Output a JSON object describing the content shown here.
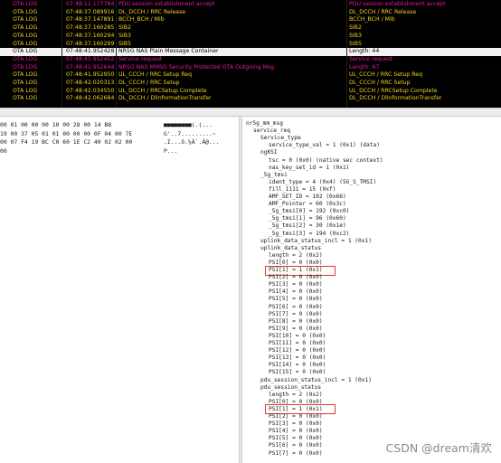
{
  "log": {
    "rows": [
      {
        "type": "OTA LOG",
        "time": "07:48:11.177784",
        "msg": "PDU session establishment accept",
        "info": "PDU session establishment accept",
        "color": "#e6199e"
      },
      {
        "type": "OTA LOG",
        "time": "07:48:37.089916",
        "msg": "DL_DCCH / RRC Release",
        "info": "DL_DCCH / RRC Release",
        "color": "#f2d51c"
      },
      {
        "type": "OTA LOG",
        "time": "07:48:37.147891",
        "msg": "BCCH_BCH / Mib",
        "info": "BCCH_BCH / Mib",
        "color": "#f2d51c"
      },
      {
        "type": "OTA LOG",
        "time": "07:48:37.160285",
        "msg": "SIB2",
        "info": "SIB2",
        "color": "#f2d51c"
      },
      {
        "type": "OTA LOG",
        "time": "07:48:37.160294",
        "msg": "SIB3",
        "info": "SIB3",
        "color": "#f2d51c"
      },
      {
        "type": "OTA LOG",
        "time": "07:48:37.160299",
        "msg": "SIB5",
        "info": "SIB5",
        "color": "#f2d51c"
      },
      {
        "type": "OTA LOG",
        "time": "07:48:41.952428",
        "msg": "NR5G NAS Plain Message Container",
        "info": "Length:  44",
        "color": "#000000",
        "selected": true
      },
      {
        "type": "OTA LOG",
        "time": "07:48:41.952452",
        "msg": "Service request",
        "info": "Service request",
        "color": "#e6199e"
      },
      {
        "type": "OTA LOG",
        "time": "07:48:41.952644",
        "msg": "NR5G NAS MMSG Security Protected OTA Outgoing Msg",
        "info": "Length:  67",
        "color": "#e6199e"
      },
      {
        "type": "OTA LOG",
        "time": "07:48:41.952950",
        "msg": "UL_CCCH / RRC Setup Req",
        "info": "UL_CCCH / RRC Setup Req",
        "color": "#f2d51c"
      },
      {
        "type": "OTA LOG",
        "time": "07:48:42.020313",
        "msg": "DL_CCCH / RRC Setup",
        "info": "DL_CCCH / RRC Setup",
        "color": "#f2d51c"
      },
      {
        "type": "OTA LOG",
        "time": "07:48:42.034550",
        "msg": "UL_DCCH / RRCSetup Complete",
        "info": "UL_DCCH / RRCSetup Complete",
        "color": "#f2d51c"
      },
      {
        "type": "OTA LOG",
        "time": "07:48:42.062684",
        "msg": "DL_DCCH / DlInformationTransfer",
        "info": "DL_DCCH / DlInformationTransfer",
        "color": "#f2d51c"
      }
    ]
  },
  "hex": {
    "lines": [
      {
        "bytes": "00 01 00 00 00 10 00 28 00 14 B8",
        "ascii": "■■■■■■■■(.(..."
      },
      {
        "bytes": "19 00 37 05 01 01 00 00 00 0F 04 00 7E",
        "ascii": "G'..7.........~"
      },
      {
        "bytes": "00 07 F4 19 BC C0 60 1E C2 40 02 02 00",
        "ascii": ".I...ô.¼À`.Â@..."
      },
      {
        "bytes": "00",
        "ascii": "P..."
      }
    ]
  },
  "tree": {
    "lines": [
      {
        "text": "nr5g_mm_msg",
        "indent": 0
      },
      {
        "text": "service_req",
        "indent": 1
      },
      {
        "text": "Service_type",
        "indent": 2
      },
      {
        "text": "service_type_val = 1 (0x1) (data)",
        "indent": 3
      },
      {
        "text": "ngKSI",
        "indent": 2
      },
      {
        "text": "tsc = 0 (0x0) (native sec context)",
        "indent": 3
      },
      {
        "text": "nas_key_set_id = 1 (0x1)",
        "indent": 3
      },
      {
        "text": "_5g_tmsi",
        "indent": 2
      },
      {
        "text": "ident_type = 4 (0x4) (5G_S_TMSI)",
        "indent": 3
      },
      {
        "text": "fill_1111 = 15 (0xf)",
        "indent": 3
      },
      {
        "text": "AMF_SET_ID = 102 (0x66)",
        "indent": 3
      },
      {
        "text": "AMF_Pointer = 60 (0x3c)",
        "indent": 3
      },
      {
        "text": "_5g_tmsi[0] = 192 (0xc0)",
        "indent": 3
      },
      {
        "text": "_5g_tmsi[1] = 96 (0x60)",
        "indent": 3
      },
      {
        "text": "_5g_tmsi[2] = 30 (0x1e)",
        "indent": 3
      },
      {
        "text": "_5g_tmsi[3] = 194 (0xc2)",
        "indent": 3
      },
      {
        "text": "uplink_data_status_incl = 1 (0x1)",
        "indent": 2
      },
      {
        "text": "uplink_data_status",
        "indent": 2
      },
      {
        "text": "length = 2 (0x2)",
        "indent": 3
      },
      {
        "text": "PSI[0] = 0 (0x0)",
        "indent": 3
      },
      {
        "text": "PSI[1] = 1 (0x1)",
        "indent": 3,
        "highlight": true
      },
      {
        "text": "PSI[2] = 0 (0x0)",
        "indent": 3
      },
      {
        "text": "PSI[3] = 0 (0x0)",
        "indent": 3
      },
      {
        "text": "PSI[4] = 0 (0x0)",
        "indent": 3
      },
      {
        "text": "PSI[5] = 0 (0x0)",
        "indent": 3
      },
      {
        "text": "PSI[6] = 0 (0x0)",
        "indent": 3
      },
      {
        "text": "PSI[7] = 0 (0x0)",
        "indent": 3
      },
      {
        "text": "PSI[8] = 0 (0x0)",
        "indent": 3
      },
      {
        "text": "PSI[9] = 0 (0x0)",
        "indent": 3
      },
      {
        "text": "PSI[10] = 0 (0x0)",
        "indent": 3
      },
      {
        "text": "PSI[11] = 0 (0x0)",
        "indent": 3
      },
      {
        "text": "PSI[12] = 0 (0x0)",
        "indent": 3
      },
      {
        "text": "PSI[13] = 0 (0x0)",
        "indent": 3
      },
      {
        "text": "PSI[14] = 0 (0x0)",
        "indent": 3
      },
      {
        "text": "PSI[15] = 0 (0x0)",
        "indent": 3
      },
      {
        "text": "pdu_session_status_incl = 1 (0x1)",
        "indent": 2
      },
      {
        "text": "pdu_session_status",
        "indent": 2
      },
      {
        "text": "length = 2 (0x2)",
        "indent": 3
      },
      {
        "text": "PSI[0] = 0 (0x0)",
        "indent": 3
      },
      {
        "text": "PSI[1] = 1 (0x1)",
        "indent": 3,
        "highlight": true
      },
      {
        "text": "PSI[2] = 0 (0x0)",
        "indent": 3
      },
      {
        "text": "PSI[3] = 0 (0x0)",
        "indent": 3
      },
      {
        "text": "PSI[4] = 0 (0x0)",
        "indent": 3
      },
      {
        "text": "PSI[5] = 0 (0x0)",
        "indent": 3
      },
      {
        "text": "PSI[6] = 0 (0x0)",
        "indent": 3
      },
      {
        "text": "PSI[7] = 0 (0x0)",
        "indent": 3
      }
    ]
  },
  "watermark": "CSDN @dream清欢",
  "colors": {
    "magenta": "#e6199e",
    "yellow": "#f2d51c",
    "highlight_border": "#e03a2a"
  }
}
